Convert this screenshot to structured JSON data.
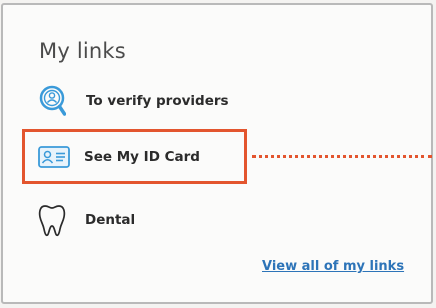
{
  "card": {
    "title": "My links",
    "links": [
      {
        "label": "To verify providers",
        "icon": "provider-search-icon"
      },
      {
        "label": "See My ID Card",
        "icon": "id-card-icon"
      },
      {
        "label": "Dental",
        "icon": "tooth-icon"
      }
    ],
    "view_all_label": "View all of my links"
  },
  "colors": {
    "highlight": "#e3552e",
    "link": "#2d74b8",
    "icon_blue": "#3a9ad9"
  }
}
